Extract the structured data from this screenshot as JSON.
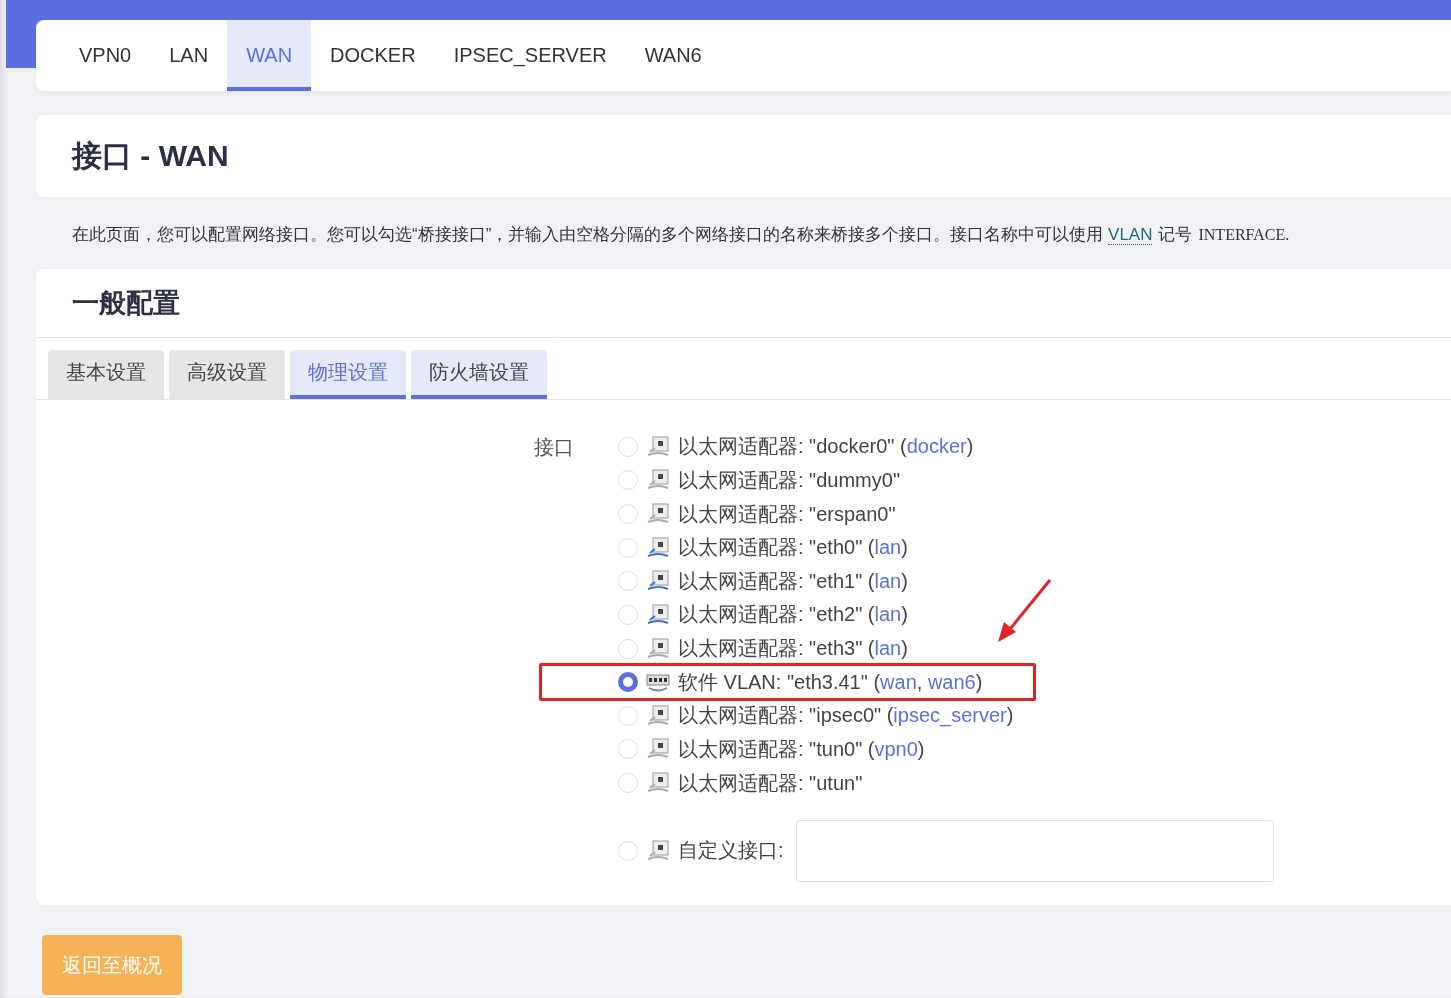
{
  "top_tabs": [
    {
      "label": "VPN0",
      "selected": false
    },
    {
      "label": "LAN",
      "selected": false
    },
    {
      "label": "WAN",
      "selected": true
    },
    {
      "label": "DOCKER",
      "selected": false
    },
    {
      "label": "IPSEC_SERVER",
      "selected": false
    },
    {
      "label": "WAN6",
      "selected": false
    }
  ],
  "page_title": "接口 - WAN",
  "description": {
    "before": "在此页面，您可以配置网络接口。您可以勾选“桥接接口”，并输入由空格分隔的多个网络接口的名称来桥接多个接口。接口名称中可以使用",
    "link": "VLAN",
    "after": "记号",
    "code": "INTERFACE."
  },
  "section_title": "一般配置",
  "section_tabs": [
    {
      "label": "基本设置",
      "selected": false,
      "kind": "plain"
    },
    {
      "label": "高级设置",
      "selected": false,
      "kind": "plain"
    },
    {
      "label": "物理设置",
      "selected": true,
      "kind": "accent"
    },
    {
      "label": "防火墙设置",
      "selected": false,
      "kind": "accent"
    }
  ],
  "field_label": "接口",
  "interfaces": [
    {
      "kind": "ethernet",
      "selected": false,
      "highlighted": false,
      "attached": false,
      "parts": [
        {
          "text": "以太网适配器: \"docker0\" ("
        },
        {
          "text": "docker",
          "link": true
        },
        {
          "text": ")"
        }
      ]
    },
    {
      "kind": "ethernet",
      "selected": false,
      "highlighted": false,
      "attached": false,
      "parts": [
        {
          "text": "以太网适配器: \"dummy0\""
        }
      ]
    },
    {
      "kind": "ethernet",
      "selected": false,
      "highlighted": false,
      "attached": false,
      "parts": [
        {
          "text": "以太网适配器: \"erspan0\""
        }
      ]
    },
    {
      "kind": "ethernet",
      "selected": false,
      "highlighted": false,
      "attached": true,
      "parts": [
        {
          "text": "以太网适配器: \"eth0\" ("
        },
        {
          "text": "lan",
          "link": true
        },
        {
          "text": ")"
        }
      ]
    },
    {
      "kind": "ethernet",
      "selected": false,
      "highlighted": false,
      "attached": true,
      "parts": [
        {
          "text": "以太网适配器: \"eth1\" ("
        },
        {
          "text": "lan",
          "link": true
        },
        {
          "text": ")"
        }
      ]
    },
    {
      "kind": "ethernet",
      "selected": false,
      "highlighted": false,
      "attached": true,
      "parts": [
        {
          "text": "以太网适配器: \"eth2\" ("
        },
        {
          "text": "lan",
          "link": true
        },
        {
          "text": ")"
        }
      ]
    },
    {
      "kind": "ethernet",
      "selected": false,
      "highlighted": false,
      "attached": false,
      "parts": [
        {
          "text": "以太网适配器: \"eth3\" ("
        },
        {
          "text": "lan",
          "link": true
        },
        {
          "text": ")"
        }
      ]
    },
    {
      "kind": "vlan",
      "selected": true,
      "highlighted": true,
      "attached": false,
      "parts": [
        {
          "text": "软件 VLAN: \"eth3.41\" ("
        },
        {
          "text": "wan",
          "link": true
        },
        {
          "text": ", "
        },
        {
          "text": "wan6",
          "link": true
        },
        {
          "text": ")"
        }
      ]
    },
    {
      "kind": "ethernet",
      "selected": false,
      "highlighted": false,
      "attached": false,
      "parts": [
        {
          "text": "以太网适配器: \"ipsec0\" ("
        },
        {
          "text": "ipsec_server",
          "link": true
        },
        {
          "text": ")"
        }
      ]
    },
    {
      "kind": "ethernet",
      "selected": false,
      "highlighted": false,
      "attached": false,
      "parts": [
        {
          "text": "以太网适配器: \"tun0\" ("
        },
        {
          "text": "vpn0",
          "link": true
        },
        {
          "text": ")"
        }
      ]
    },
    {
      "kind": "ethernet",
      "selected": false,
      "highlighted": false,
      "attached": false,
      "parts": [
        {
          "text": "以太网适配器: \"utun\""
        }
      ]
    },
    {
      "kind": "custom",
      "selected": false,
      "highlighted": false,
      "attached": false,
      "parts": [
        {
          "text": "自定义接口:"
        }
      ]
    }
  ],
  "back_button": "返回至概况"
}
